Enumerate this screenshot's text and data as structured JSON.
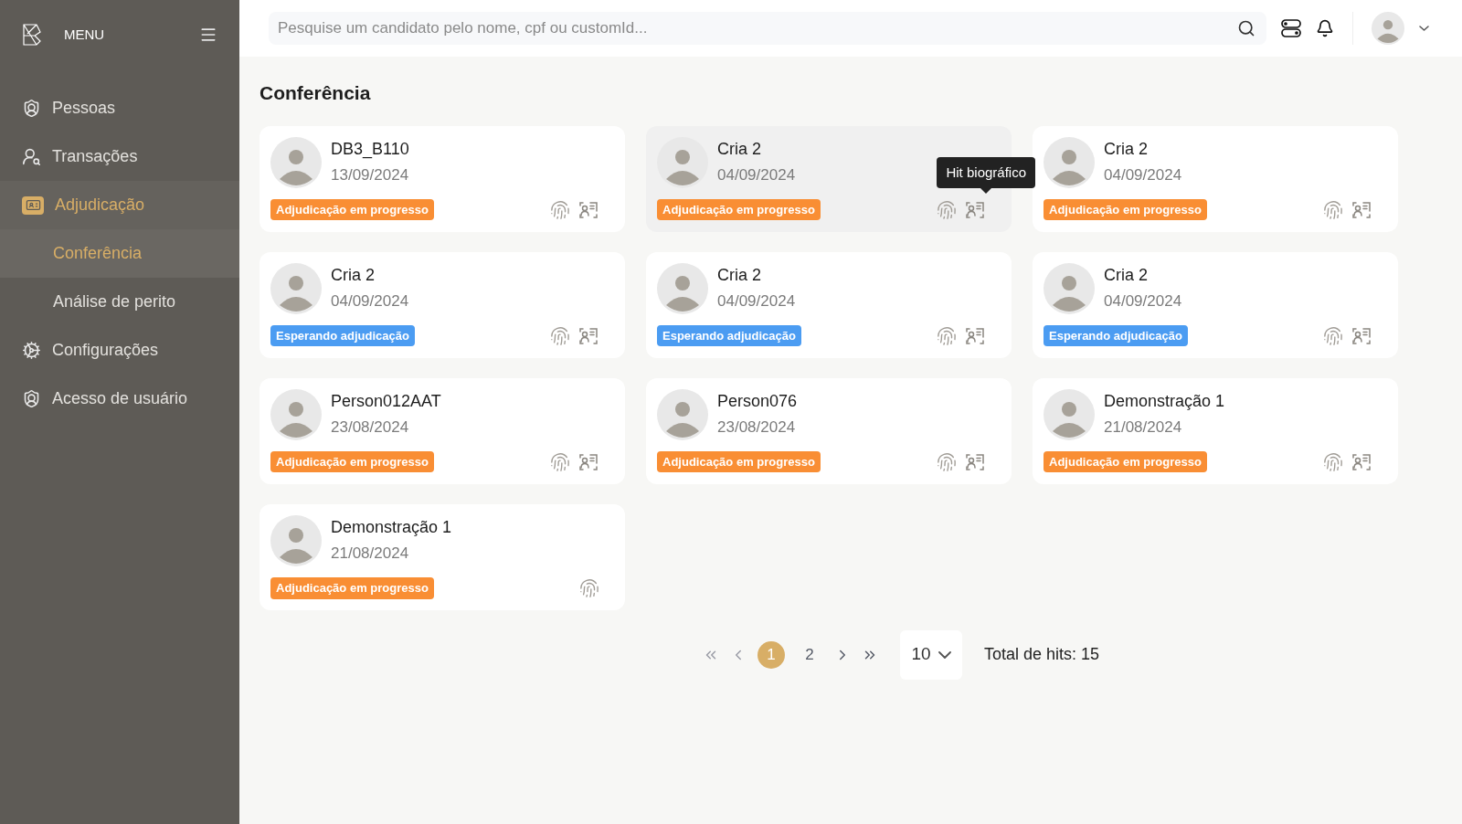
{
  "sidebar": {
    "title": "MENU",
    "items": [
      {
        "label": "Pessoas",
        "selected": false
      },
      {
        "label": "Transações",
        "selected": false
      },
      {
        "label": "Adjudicação",
        "selected": true,
        "children": [
          {
            "label": "Conferência",
            "selected": true
          },
          {
            "label": "Análise de perito",
            "selected": false
          }
        ]
      },
      {
        "label": "Configurações",
        "selected": false
      },
      {
        "label": "Acesso de usuário",
        "selected": false
      }
    ]
  },
  "search": {
    "placeholder": "Pesquise um candidato pelo nome, cpf ou customId..."
  },
  "page_title": "Conferência",
  "cards": [
    {
      "name": "DB3_B110",
      "date": "13/09/2024",
      "status": {
        "kind": "progress",
        "label": "Adjudicação em progresso"
      },
      "highlighted": false,
      "biographic_hit": true
    },
    {
      "name": "Cria 2",
      "date": "04/09/2024",
      "status": {
        "kind": "progress",
        "label": "Adjudicação em progresso"
      },
      "highlighted": true,
      "biographic_hit": true,
      "tooltip": "Hit biográfico"
    },
    {
      "name": "Cria 2",
      "date": "04/09/2024",
      "status": {
        "kind": "progress",
        "label": "Adjudicação em progresso"
      },
      "highlighted": false,
      "biographic_hit": true
    },
    {
      "name": "Cria 2",
      "date": "04/09/2024",
      "status": {
        "kind": "waiting",
        "label": "Esperando adjudicação"
      },
      "highlighted": false,
      "biographic_hit": true
    },
    {
      "name": "Cria 2",
      "date": "04/09/2024",
      "status": {
        "kind": "waiting",
        "label": "Esperando adjudicação"
      },
      "highlighted": false,
      "biographic_hit": true
    },
    {
      "name": "Cria 2",
      "date": "04/09/2024",
      "status": {
        "kind": "waiting",
        "label": "Esperando adjudicação"
      },
      "highlighted": false,
      "biographic_hit": true
    },
    {
      "name": "Person012AAT",
      "date": "23/08/2024",
      "status": {
        "kind": "progress",
        "label": "Adjudicação em progresso"
      },
      "highlighted": false,
      "biographic_hit": true
    },
    {
      "name": "Person076",
      "date": "23/08/2024",
      "status": {
        "kind": "progress",
        "label": "Adjudicação em progresso"
      },
      "highlighted": false,
      "biographic_hit": true
    },
    {
      "name": "Demonstração 1",
      "date": "21/08/2024",
      "status": {
        "kind": "progress",
        "label": "Adjudicação em progresso"
      },
      "highlighted": false,
      "biographic_hit": true
    },
    {
      "name": "Demonstração 1",
      "date": "21/08/2024",
      "status": {
        "kind": "progress",
        "label": "Adjudicação em progresso"
      },
      "highlighted": false,
      "biographic_hit": false
    }
  ],
  "pagination": {
    "pages": [
      {
        "label": "1",
        "selected": true
      },
      {
        "label": "2",
        "selected": false
      }
    ],
    "page_size": "10",
    "total": "Total de hits: 15"
  }
}
